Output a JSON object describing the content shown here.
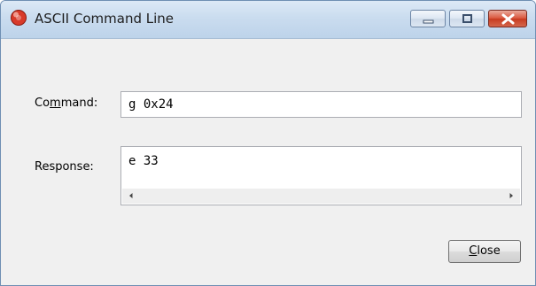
{
  "window": {
    "title": "ASCII Command Line",
    "icon": "red-app-icon"
  },
  "title_controls": {
    "minimize_icon": "minimize-icon",
    "maximize_icon": "maximize-icon",
    "close_icon": "close-icon"
  },
  "command": {
    "label_before": "Co",
    "label_mnemonic": "m",
    "label_after": "mand:",
    "value": "g 0x24"
  },
  "response": {
    "label": "Response:",
    "value": "e 33",
    "scroll_left_icon": "scroll-left-arrow-icon",
    "scroll_right_icon": "scroll-right-arrow-icon"
  },
  "close_button": {
    "mnemonic": "C",
    "rest": "lose"
  },
  "colors": {
    "titlebar": "#cadcef",
    "close_control": "#d9543a",
    "client_background": "#f0f0f0"
  }
}
